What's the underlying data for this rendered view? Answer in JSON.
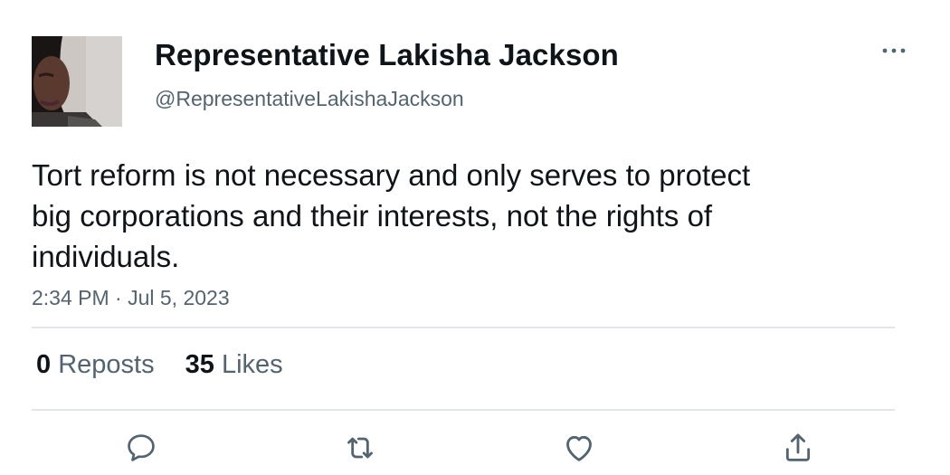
{
  "tweet": {
    "author": {
      "display_name": "Representative Lakisha Jackson",
      "handle": "@RepresentativeLakishaJackson"
    },
    "text": "Tort reform is not necessary and only serves to protect big corporations and their interests, not the rights of individuals.",
    "timestamp": "2:34 PM · Jul 5, 2023",
    "stats": {
      "reposts_count": "0",
      "reposts_label": "Reposts",
      "likes_count": "35",
      "likes_label": "Likes"
    },
    "actions": [
      "reply-icon",
      "repost-icon",
      "like-icon",
      "share-icon"
    ],
    "more_icon": "more-options-icon"
  },
  "colors": {
    "text_primary": "#0f1419",
    "text_secondary": "#536471",
    "divider": "#e3e6e9"
  }
}
